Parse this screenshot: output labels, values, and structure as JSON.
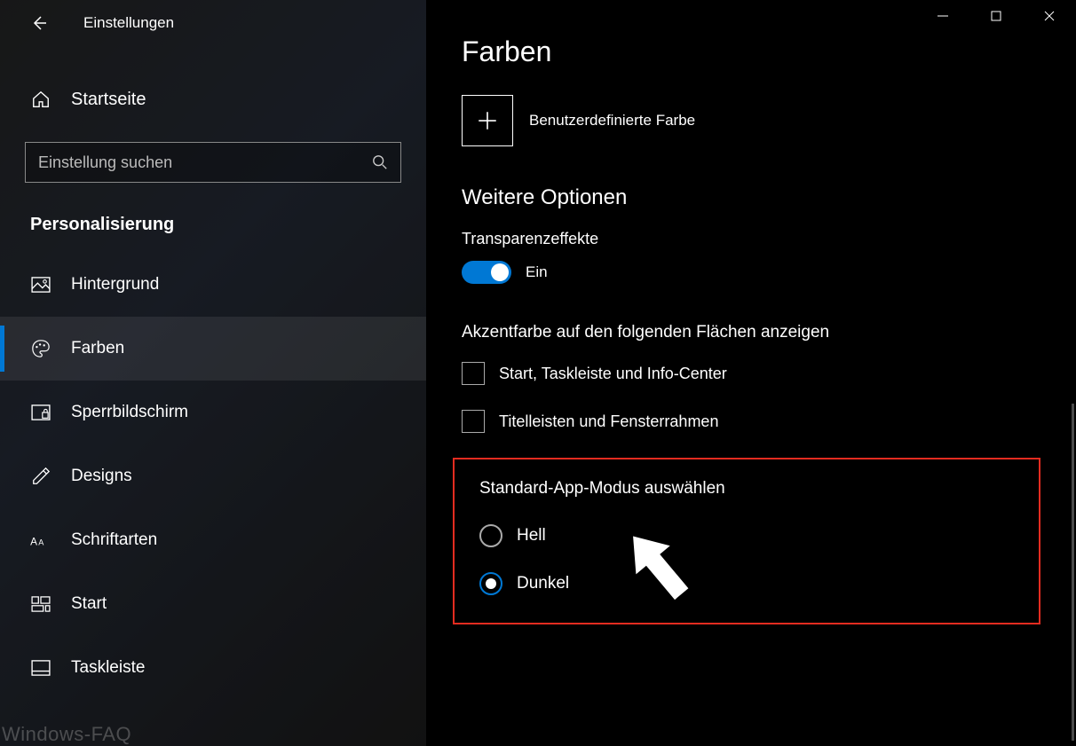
{
  "app_title": "Einstellungen",
  "home_label": "Startseite",
  "search_placeholder": "Einstellung suchen",
  "category": "Personalisierung",
  "nav": [
    {
      "label": "Hintergrund",
      "active": false
    },
    {
      "label": "Farben",
      "active": true
    },
    {
      "label": "Sperrbildschirm",
      "active": false
    },
    {
      "label": "Designs",
      "active": false
    },
    {
      "label": "Schriftarten",
      "active": false
    },
    {
      "label": "Start",
      "active": false
    },
    {
      "label": "Taskleiste",
      "active": false
    }
  ],
  "page_title": "Farben",
  "custom_color_label": "Benutzerdefinierte Farbe",
  "more_options": "Weitere Optionen",
  "transparency": {
    "label": "Transparenzeffekte",
    "state": "Ein",
    "on": true
  },
  "accent_heading": "Akzentfarbe auf den folgenden Flächen anzeigen",
  "accent_options": [
    "Start, Taskleiste und Info-Center",
    "Titelleisten und Fensterrahmen"
  ],
  "app_mode": {
    "heading": "Standard-App-Modus auswählen",
    "options": [
      {
        "label": "Hell",
        "selected": false
      },
      {
        "label": "Dunkel",
        "selected": true
      }
    ]
  },
  "watermark": "Windows-FAQ",
  "colors": {
    "accent": "#0078d4",
    "highlight": "#e32c20"
  }
}
